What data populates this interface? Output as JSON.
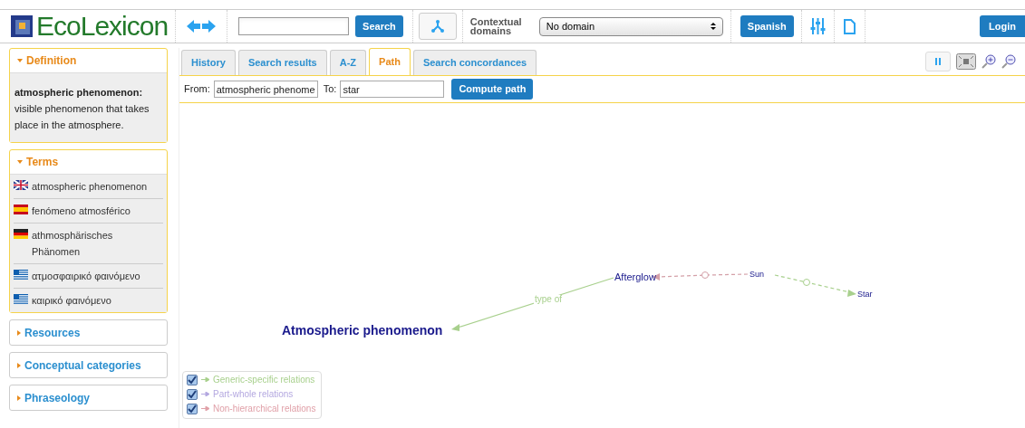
{
  "header": {
    "logo": "EcoLexicon",
    "search_button": "Search",
    "contextual_label": "Contextual domains",
    "domain_select": "No domain",
    "language_button": "Spanish",
    "login_button": "Login"
  },
  "sidebar": [
    {
      "title": "Definition",
      "expanded": true,
      "kind": "definition",
      "term": "atmospheric phenomenon:",
      "text": "visible phenomenon that takes place in the atmosphere."
    },
    {
      "title": "Terms",
      "expanded": true,
      "kind": "terms",
      "terms": [
        {
          "label": "atmospheric phenomenon",
          "kind": "en"
        },
        {
          "label": "fenómeno atmosférico",
          "kind": "es"
        },
        {
          "label": "athmosphärisches Phänomen",
          "kind": "de"
        },
        {
          "label": "ατμοσφαιρικό φαινόμενο",
          "kind": "el"
        },
        {
          "label": "καιρικό φαινόμενο",
          "kind": "el"
        }
      ]
    },
    {
      "title": "Resources",
      "expanded": false
    },
    {
      "title": "Conceptual categories",
      "expanded": false
    },
    {
      "title": "Phraseology",
      "expanded": false
    }
  ],
  "tabs": [
    {
      "label": "History",
      "selected": false
    },
    {
      "label": "Search results",
      "selected": false
    },
    {
      "label": "A-Z",
      "selected": false
    },
    {
      "label": "Path",
      "selected": true
    },
    {
      "label": "Search concordances",
      "selected": false
    }
  ],
  "path_form": {
    "from_label": "From:",
    "from_value": "atmospheric phenome",
    "to_label": "To:",
    "to_value": "star",
    "button": "Compute path"
  },
  "graph": {
    "nodes": [
      {
        "label": "Atmospheric phenomenon",
        "kind": "main"
      },
      {
        "label": "Afterglow",
        "kind": "normal"
      },
      {
        "label": "Sun",
        "kind": "small"
      },
      {
        "label": "Star",
        "kind": "small"
      }
    ],
    "edges": [
      {
        "kind": "generic",
        "label": "type of"
      },
      {
        "kind": "nonhierarchical"
      },
      {
        "kind": "generic"
      }
    ]
  },
  "legend": [
    {
      "label": "Generic-specific relations",
      "checked": true,
      "color": "#a8d08d"
    },
    {
      "label": "Part-whole relations",
      "checked": true,
      "color": "#b4a8e0"
    },
    {
      "label": "Non-hierarchical relations",
      "checked": true,
      "color": "#e0a0a8"
    }
  ]
}
